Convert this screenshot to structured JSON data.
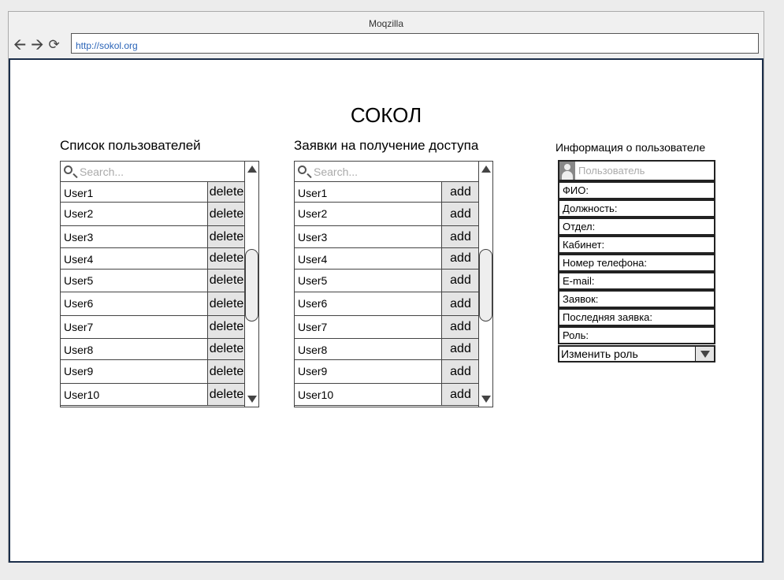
{
  "window": {
    "title": "Moqzilla",
    "url": "http://sokol.org"
  },
  "app": {
    "title": "СОКОЛ"
  },
  "users_panel": {
    "title": "Список пользователей",
    "search_placeholder": "Search...",
    "action_label": "delete",
    "items": [
      "User1",
      "User2",
      "User3",
      "User4",
      "User5",
      "User6",
      "User7",
      "User8",
      "User9",
      "User10"
    ]
  },
  "requests_panel": {
    "title": "Заявки на получение доступа",
    "search_placeholder": "Search...",
    "action_label": "add",
    "items": [
      "User1",
      "User2",
      "User3",
      "User4",
      "User5",
      "User6",
      "User7",
      "User8",
      "User9",
      "User10"
    ]
  },
  "info_panel": {
    "title": "Информация о пользователе",
    "user_placeholder": "Пользователь",
    "fields": [
      "ФИО:",
      "Должность:",
      "Отдел:",
      "Кабинет:",
      "Номер телефона:",
      "E-mail:",
      "Заявок:",
      "Последняя заявка:",
      "Роль:"
    ],
    "role_select": "Изменить роль"
  },
  "icons": [
    "back-arrow-icon",
    "forward-arrow-icon",
    "reload-icon",
    "search-icon",
    "user-avatar-icon",
    "chevron-down-icon"
  ]
}
